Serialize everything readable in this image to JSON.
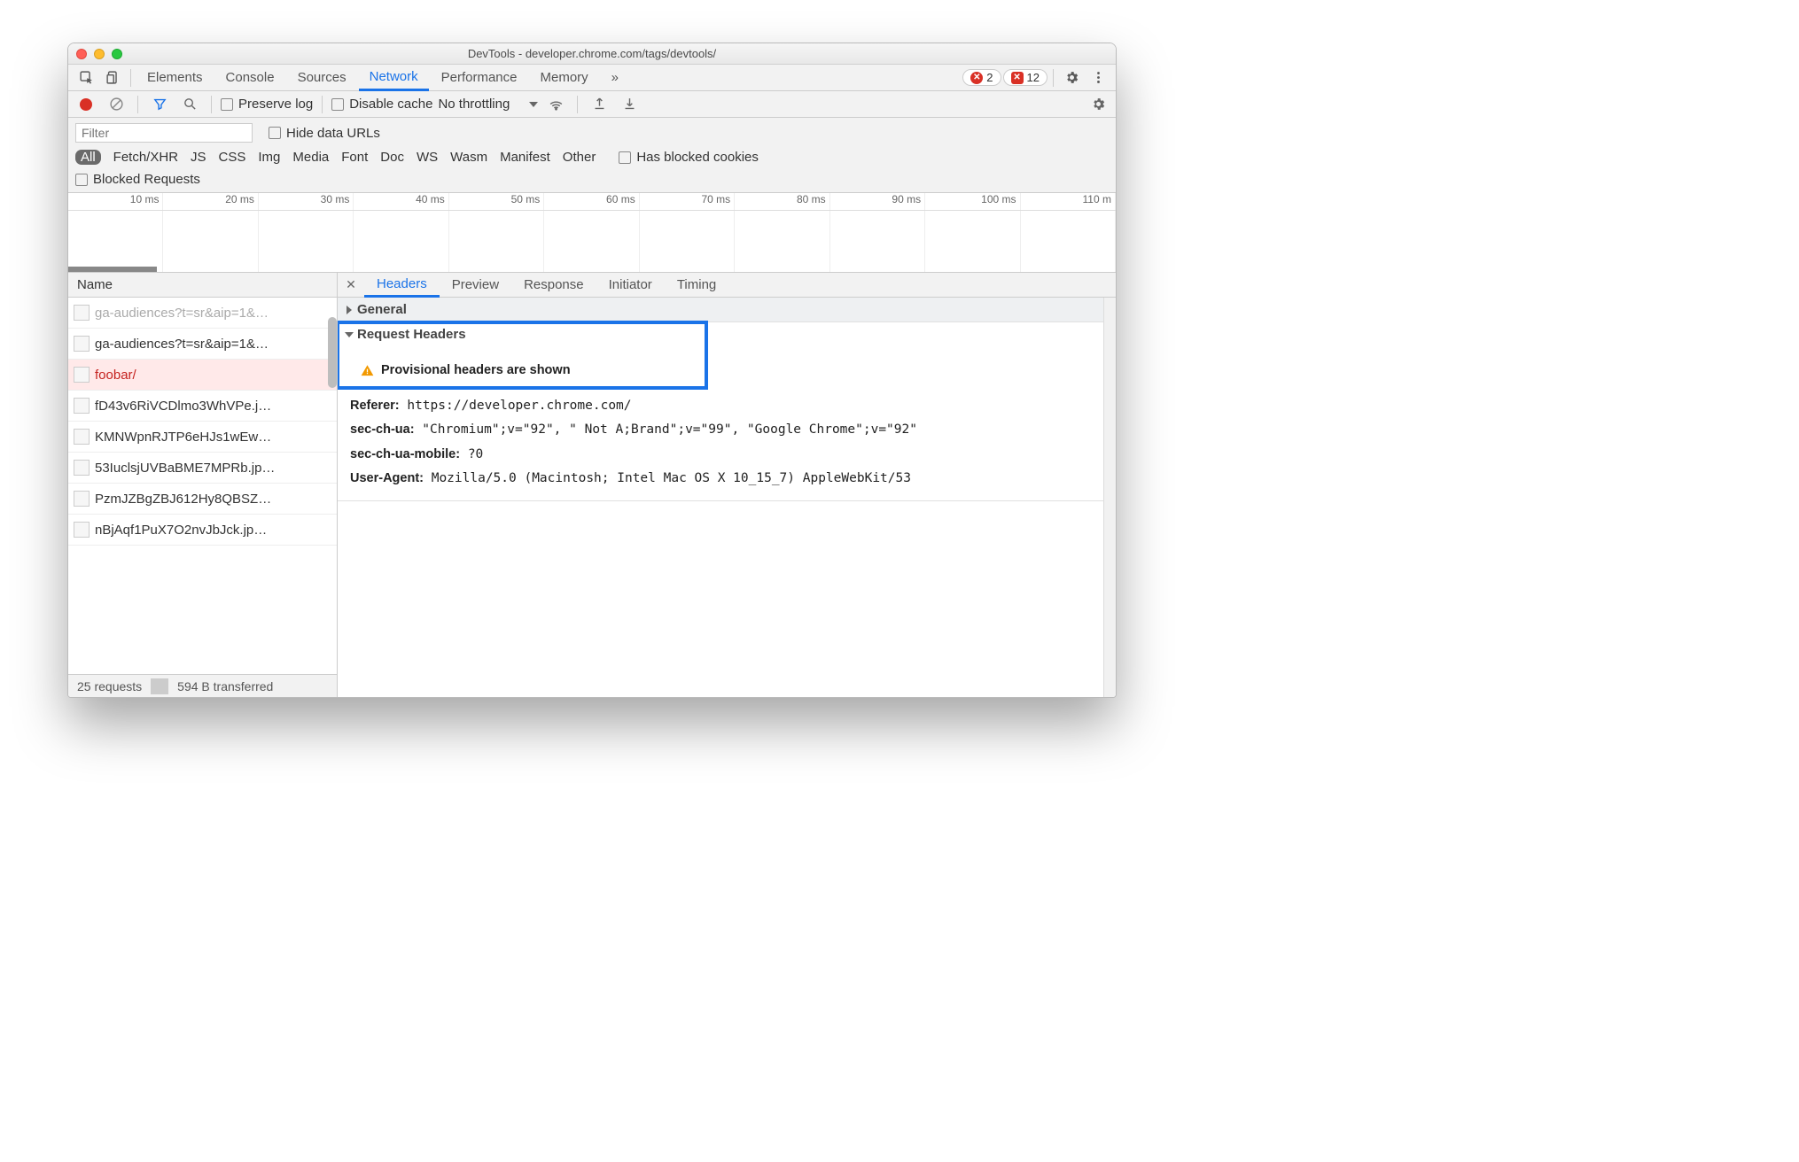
{
  "window": {
    "title": "DevTools - developer.chrome.com/tags/devtools/"
  },
  "tabs": {
    "items": [
      "Elements",
      "Console",
      "Sources",
      "Network",
      "Performance",
      "Memory"
    ],
    "active": "Network",
    "overflow": "»",
    "errors_circle": "2",
    "errors_square": "12"
  },
  "netbar": {
    "preserve": "Preserve log",
    "disable": "Disable cache",
    "throttling": "No throttling"
  },
  "filter": {
    "placeholder": "Filter",
    "hide": "Hide data URLs",
    "chips": [
      "All",
      "Fetch/XHR",
      "JS",
      "CSS",
      "Img",
      "Media",
      "Font",
      "Doc",
      "WS",
      "Wasm",
      "Manifest",
      "Other"
    ],
    "blocked_cookies": "Has blocked cookies",
    "blocked_req": "Blocked Requests"
  },
  "timeline": {
    "labels": [
      "10 ms",
      "20 ms",
      "30 ms",
      "40 ms",
      "50 ms",
      "60 ms",
      "70 ms",
      "80 ms",
      "90 ms",
      "100 ms",
      "110 m"
    ]
  },
  "requests": {
    "col": "Name",
    "rows": [
      {
        "name": "ga-audiences?t=sr&aip=1&…",
        "cut": true
      },
      {
        "name": "ga-audiences?t=sr&aip=1&…"
      },
      {
        "name": "foobar/",
        "failed": true
      },
      {
        "name": "fD43v6RiVCDlmo3WhVPe.j…"
      },
      {
        "name": "KMNWpnRJTP6eHJs1wEw…"
      },
      {
        "name": "53IuclsjUVBaBME7MPRb.jp…"
      },
      {
        "name": "PzmJZBgZBJ612Hy8QBSZ…"
      },
      {
        "name": "nBjAqf1PuX7O2nvJbJck.jp…"
      }
    ],
    "status_count": "25 requests",
    "status_xfer": "594 B transferred"
  },
  "detail": {
    "tabs": [
      "Headers",
      "Preview",
      "Response",
      "Initiator",
      "Timing"
    ],
    "active": "Headers",
    "general": "General",
    "req_hdr": "Request Headers",
    "provisional": "Provisional headers are shown",
    "headers": {
      "Referer": "https://developer.chrome.com/",
      "sec-ch-ua": "\"Chromium\";v=\"92\", \" Not A;Brand\";v=\"99\", \"Google Chrome\";v=\"92\"",
      "sec-ch-ua-mobile": "?0",
      "User-Agent": "Mozilla/5.0 (Macintosh; Intel Mac OS X 10_15_7) AppleWebKit/53"
    }
  }
}
